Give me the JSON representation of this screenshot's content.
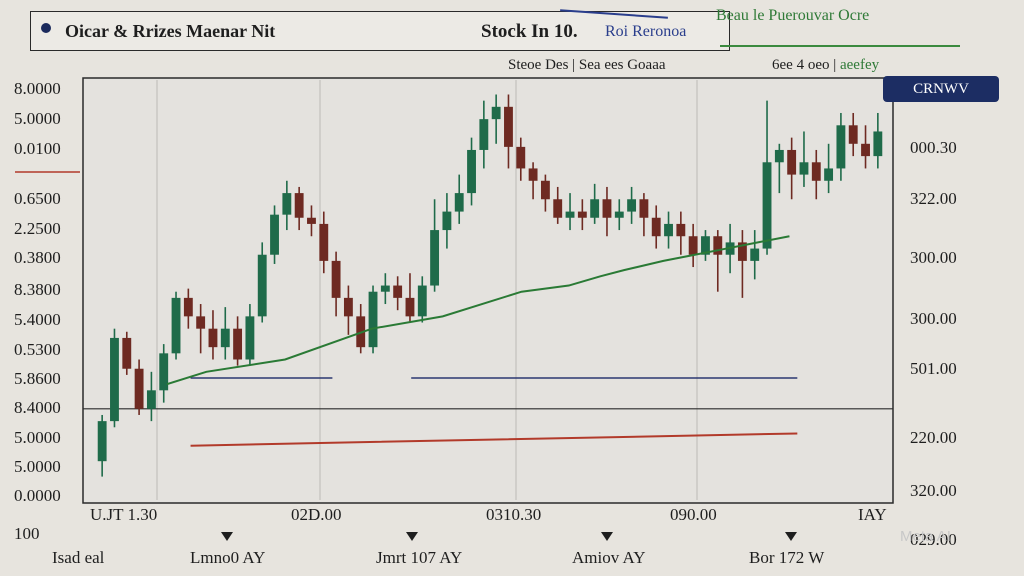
{
  "header": {
    "app_title": "Oicar & Rrizes Maenar Nit",
    "stock_title": "Stock In 10.",
    "stock_subtitle": "Roi Reronoa",
    "top_right_label": "Beau le Puerouvar Ocre"
  },
  "info_bar": {
    "left_text": "Steoe Des  |  Sea ees Goaaa",
    "right_prefix": "6ee  4 oeo  |",
    "right_highlight": "aeefey"
  },
  "toolbar": {
    "crvw_label": "CRNWV"
  },
  "bottom_labels": [
    "Isad eal",
    "Lmno0 AY",
    "Jmrt 107 AY",
    "Amiov AY",
    "Bor 172 W"
  ],
  "corner_label": "100",
  "watermark": "Meta AI",
  "colors": {
    "bull": "#1f6b4a",
    "bear": "#6e2a22",
    "moving_average": "#2a7a35",
    "support_line": "#2b3770",
    "red_trend": "#b23a2a",
    "button_bg": "#1c2d63"
  },
  "chart_data": {
    "type": "candlestick",
    "title": "Stock In 10.",
    "y_labels_left": [
      "8.0000",
      "5.0000",
      "0.0100",
      "0.6500",
      "2.2500",
      "0.3800",
      "8.3800",
      "5.4000",
      "0.5300",
      "5.8600",
      "8.4000",
      "5.0000",
      "5.0000",
      "0.0000"
    ],
    "y_labels_right": [
      "000.30",
      "322.00",
      "300.00",
      "300.00",
      "501.00",
      "220.00",
      "320.00",
      "029.00"
    ],
    "x_labels": [
      "U.JT 1.30",
      "02D.00",
      "0310.30",
      "090.00",
      "IAY"
    ],
    "ylim": [
      0,
      100
    ],
    "ohlc": [
      [
        5,
        18,
        0,
        20
      ],
      [
        18,
        45,
        16,
        48
      ],
      [
        45,
        35,
        33,
        47
      ],
      [
        35,
        22,
        20,
        38
      ],
      [
        22,
        28,
        18,
        34
      ],
      [
        28,
        40,
        24,
        43
      ],
      [
        40,
        58,
        38,
        60
      ],
      [
        58,
        52,
        48,
        61
      ],
      [
        52,
        48,
        40,
        56
      ],
      [
        48,
        42,
        38,
        54
      ],
      [
        42,
        48,
        38,
        55
      ],
      [
        48,
        38,
        36,
        52
      ],
      [
        38,
        52,
        36,
        56
      ],
      [
        52,
        72,
        50,
        76
      ],
      [
        72,
        85,
        69,
        88
      ],
      [
        85,
        92,
        80,
        96
      ],
      [
        92,
        84,
        80,
        94
      ],
      [
        84,
        82,
        78,
        88
      ],
      [
        82,
        70,
        66,
        86
      ],
      [
        70,
        58,
        52,
        73
      ],
      [
        58,
        52,
        46,
        62
      ],
      [
        52,
        42,
        40,
        56
      ],
      [
        42,
        60,
        40,
        62
      ],
      [
        60,
        62,
        56,
        66
      ],
      [
        62,
        58,
        54,
        65
      ],
      [
        58,
        52,
        50,
        66
      ],
      [
        52,
        62,
        50,
        65
      ],
      [
        62,
        80,
        60,
        90
      ],
      [
        80,
        86,
        74,
        92
      ],
      [
        86,
        92,
        82,
        98
      ],
      [
        92,
        106,
        88,
        110
      ],
      [
        106,
        116,
        100,
        122
      ],
      [
        116,
        120,
        108,
        124
      ],
      [
        120,
        107,
        100,
        124
      ],
      [
        107,
        100,
        96,
        110
      ],
      [
        100,
        96,
        90,
        102
      ],
      [
        96,
        90,
        86,
        98
      ],
      [
        90,
        84,
        82,
        94
      ],
      [
        84,
        86,
        80,
        92
      ],
      [
        86,
        84,
        80,
        90
      ],
      [
        84,
        90,
        82,
        95
      ],
      [
        90,
        84,
        78,
        94
      ],
      [
        84,
        86,
        80,
        90
      ],
      [
        86,
        90,
        82,
        94
      ],
      [
        90,
        84,
        78,
        92
      ],
      [
        84,
        78,
        74,
        88
      ],
      [
        78,
        82,
        74,
        86
      ],
      [
        82,
        78,
        72,
        86
      ],
      [
        78,
        72,
        68,
        82
      ],
      [
        72,
        78,
        70,
        80
      ],
      [
        78,
        72,
        60,
        80
      ],
      [
        72,
        76,
        66,
        82
      ],
      [
        76,
        70,
        58,
        80
      ],
      [
        70,
        74,
        64,
        80
      ],
      [
        74,
        102,
        72,
        122
      ],
      [
        102,
        106,
        92,
        108
      ],
      [
        106,
        98,
        90,
        110
      ],
      [
        98,
        102,
        94,
        112
      ],
      [
        102,
        96,
        90,
        106
      ],
      [
        96,
        100,
        92,
        108
      ],
      [
        100,
        114,
        96,
        118
      ],
      [
        114,
        108,
        104,
        118
      ],
      [
        108,
        104,
        100,
        114
      ],
      [
        104,
        112,
        100,
        118
      ]
    ],
    "moving_average": [
      [
        9,
        30
      ],
      [
        14,
        34
      ],
      [
        24,
        38
      ],
      [
        35,
        48
      ],
      [
        44,
        52
      ],
      [
        54,
        60
      ],
      [
        60,
        62
      ],
      [
        64,
        65
      ],
      [
        67,
        67
      ],
      [
        72,
        70
      ],
      [
        76,
        72
      ],
      [
        80,
        74
      ],
      [
        84,
        76
      ],
      [
        88,
        78
      ]
    ],
    "support_lines": [
      {
        "y": 32,
        "x_from": 12,
        "x_to": 30
      },
      {
        "y": 32,
        "x_from": 40,
        "x_to": 89
      }
    ],
    "horizontal_line": {
      "y": 22,
      "x_from": 0,
      "x_to": 100
    },
    "red_trend": [
      [
        12,
        10
      ],
      [
        30,
        11
      ],
      [
        50,
        12
      ],
      [
        70,
        13
      ],
      [
        89,
        14
      ]
    ]
  }
}
